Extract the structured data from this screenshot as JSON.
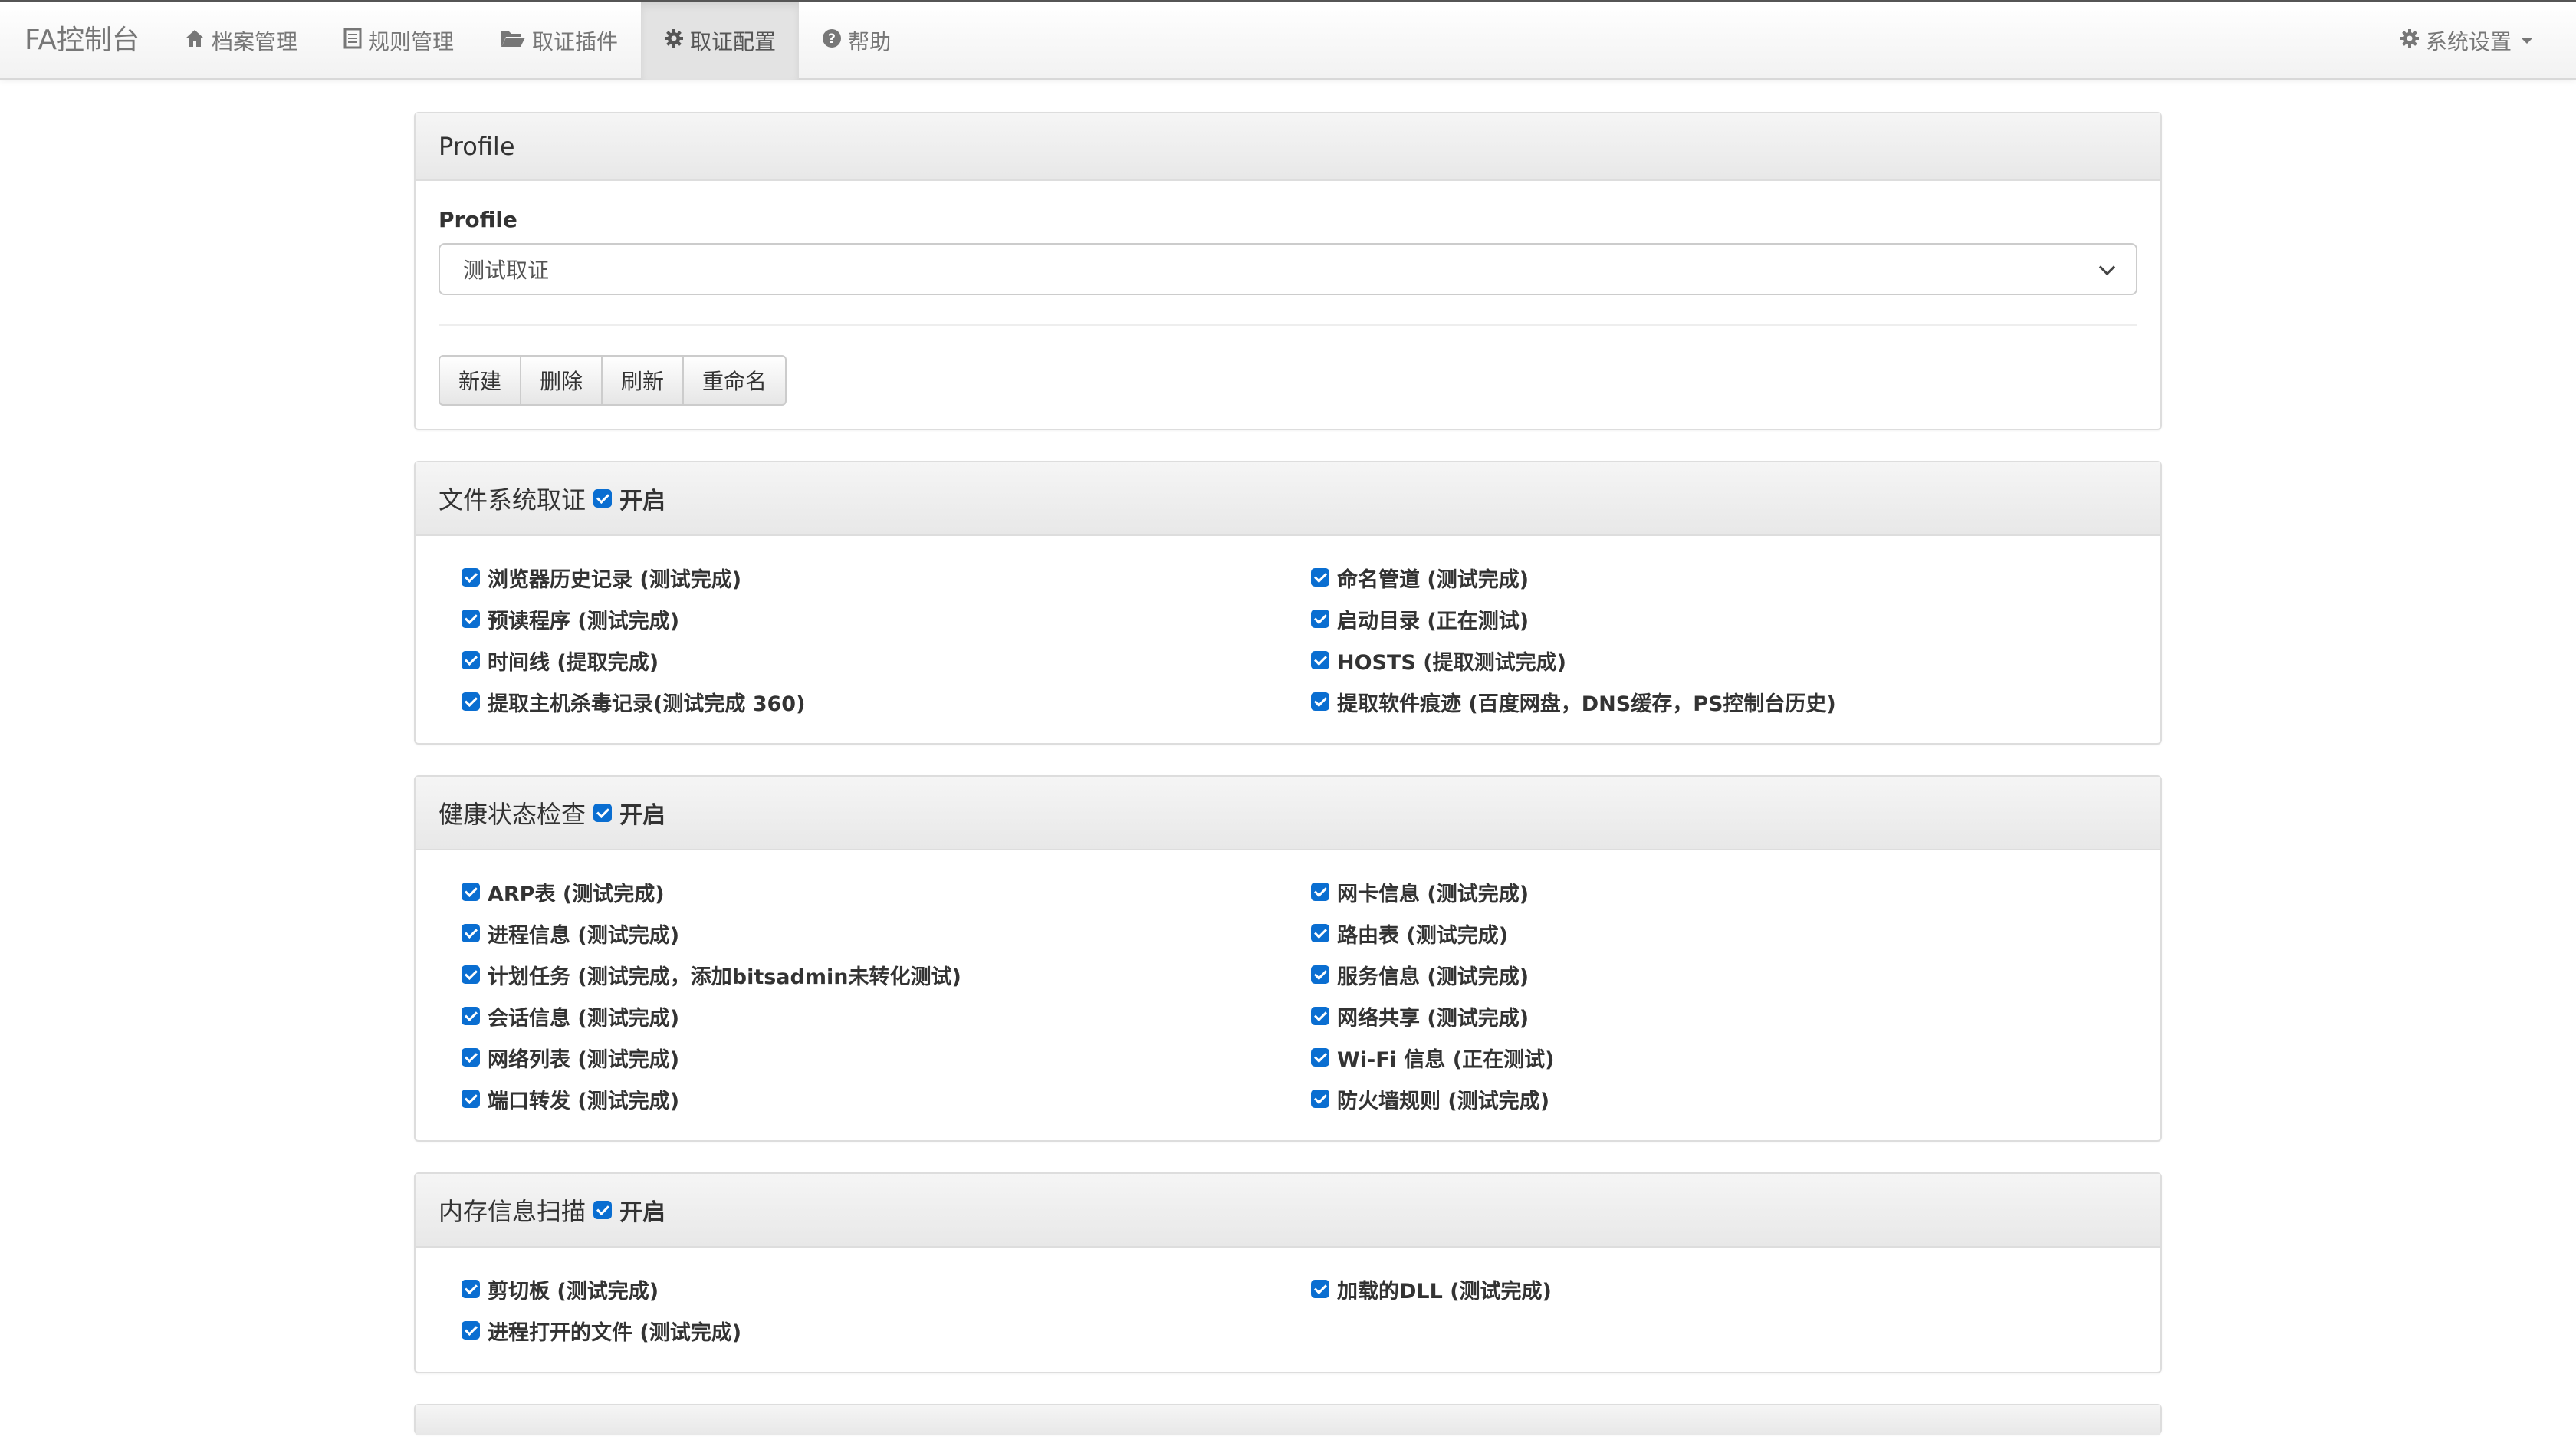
{
  "navbar": {
    "brand": "FA控制台",
    "items": [
      {
        "label": "档案管理",
        "icon": "home-icon"
      },
      {
        "label": "规则管理",
        "icon": "list-icon"
      },
      {
        "label": "取证插件",
        "icon": "folder-open-icon"
      },
      {
        "label": "取证配置",
        "icon": "gear-icon",
        "active": true
      },
      {
        "label": "帮助",
        "icon": "question-circle-icon"
      }
    ],
    "settings_label": "系统设置"
  },
  "profile": {
    "heading": "Profile",
    "field_label": "Profile",
    "selected": "测试取证",
    "buttons": [
      "新建",
      "删除",
      "刷新",
      "重命名"
    ]
  },
  "sections": [
    {
      "title": "文件系统取证",
      "toggle_label": "开启",
      "left": [
        "浏览器历史记录 (测试完成)",
        "预读程序 (测试完成)",
        "时间线 (提取完成)",
        "提取主机杀毒记录(测试完成 360)"
      ],
      "right": [
        "命名管道 (测试完成)",
        "启动目录 (正在测试)",
        "HOSTS (提取测试完成)",
        "提取软件痕迹 (百度网盘，DNS缓存，PS控制台历史)"
      ]
    },
    {
      "title": "健康状态检查",
      "toggle_label": "开启",
      "left": [
        "ARP表 (测试完成)",
        "进程信息 (测试完成)",
        "计划任务 (测试完成，添加bitsadmin未转化测试)",
        "会话信息 (测试完成)",
        "网络列表 (测试完成)",
        "端口转发 (测试完成)"
      ],
      "right": [
        "网卡信息 (测试完成)",
        "路由表 (测试完成)",
        "服务信息 (测试完成)",
        "网络共享 (测试完成)",
        "Wi-Fi 信息 (正在测试)",
        "防火墙规则 (测试完成)"
      ]
    },
    {
      "title": "内存信息扫描",
      "toggle_label": "开启",
      "left": [
        "剪切板 (测试完成)",
        "进程打开的文件 (测试完成)"
      ],
      "right": [
        "加载的DLL (测试完成)"
      ]
    }
  ],
  "colors": {
    "checkbox": "#0a6ed1",
    "active_nav_bg": "#e3e3e3"
  }
}
